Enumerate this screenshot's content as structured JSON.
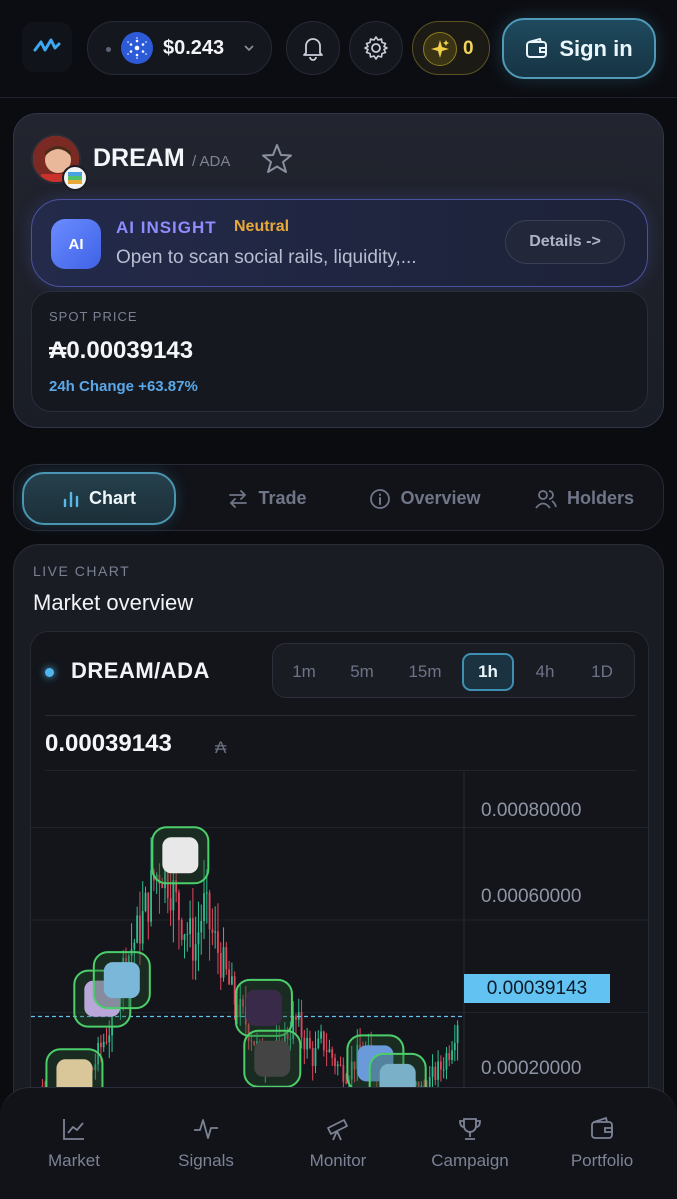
{
  "header": {
    "price": "$0.243",
    "points": "0",
    "sign_in_label": "Sign in"
  },
  "token": {
    "symbol": "DREAM",
    "quote_suffix": "/ ADA",
    "ai": {
      "badge": "AI",
      "title": "AI INSIGHT",
      "sentiment": "Neutral",
      "description": "Open to scan social rails, liquidity,...",
      "details_label": "Details ->"
    },
    "spot": {
      "label": "SPOT PRICE",
      "value": "₳0.00039143",
      "change": "24h Change +63.87%"
    }
  },
  "tabs": [
    {
      "label": "Chart",
      "icon": "bar-chart-icon",
      "active": true
    },
    {
      "label": "Trade",
      "icon": "swap-icon",
      "active": false
    },
    {
      "label": "Overview",
      "icon": "info-icon",
      "active": false
    },
    {
      "label": "Holders",
      "icon": "users-icon",
      "active": false
    }
  ],
  "chart_section": {
    "eyebrow": "LIVE CHART",
    "title": "Market overview",
    "pair": "DREAM/ADA",
    "timeframes": [
      "1m",
      "5m",
      "15m",
      "1h",
      "4h",
      "1D"
    ],
    "active_timeframe": "1h",
    "last_price": "0.00039143",
    "last_price_unit": "₳",
    "price_tag": "0.00039143"
  },
  "chart_data": {
    "type": "candlestick",
    "y_ticks": [
      "0.00080000",
      "0.00060000",
      "0.00020000"
    ],
    "ylim": [
      0.00012,
      0.00092
    ],
    "current_price": 0.00039143,
    "colors": {
      "up": "#2fbf8f",
      "down": "#e0475c",
      "marker_glow": "#4ccf6a",
      "current_line": "#62c2f2"
    },
    "close_path": [
      0.00024,
      0.00019,
      0.00016,
      0.00021,
      0.00018,
      0.00026,
      0.00028,
      0.00033,
      0.00037,
      0.00047,
      0.00052,
      0.00056,
      0.00061,
      0.00068,
      0.00072,
      0.00069,
      0.00062,
      0.00058,
      0.00054,
      0.00063,
      0.00057,
      0.00052,
      0.00046,
      0.00041,
      0.00038,
      0.00034,
      0.00029,
      0.00033,
      0.00031,
      0.00036,
      0.00038,
      0.00034,
      0.0003,
      0.00034,
      0.00031,
      0.00028,
      0.00027,
      0.0003,
      0.00032,
      0.00029,
      0.00026,
      0.00024,
      0.00022,
      0.00021,
      0.00024,
      0.00023,
      0.00026,
      0.00028,
      0.00032,
      0.00039
    ]
  },
  "nav": [
    {
      "label": "Market",
      "icon": "line-chart-icon"
    },
    {
      "label": "Signals",
      "icon": "pulse-icon"
    },
    {
      "label": "Monitor",
      "icon": "telescope-icon"
    },
    {
      "label": "Campaign",
      "icon": "trophy-icon"
    },
    {
      "label": "Portfolio",
      "icon": "wallet-icon"
    }
  ]
}
